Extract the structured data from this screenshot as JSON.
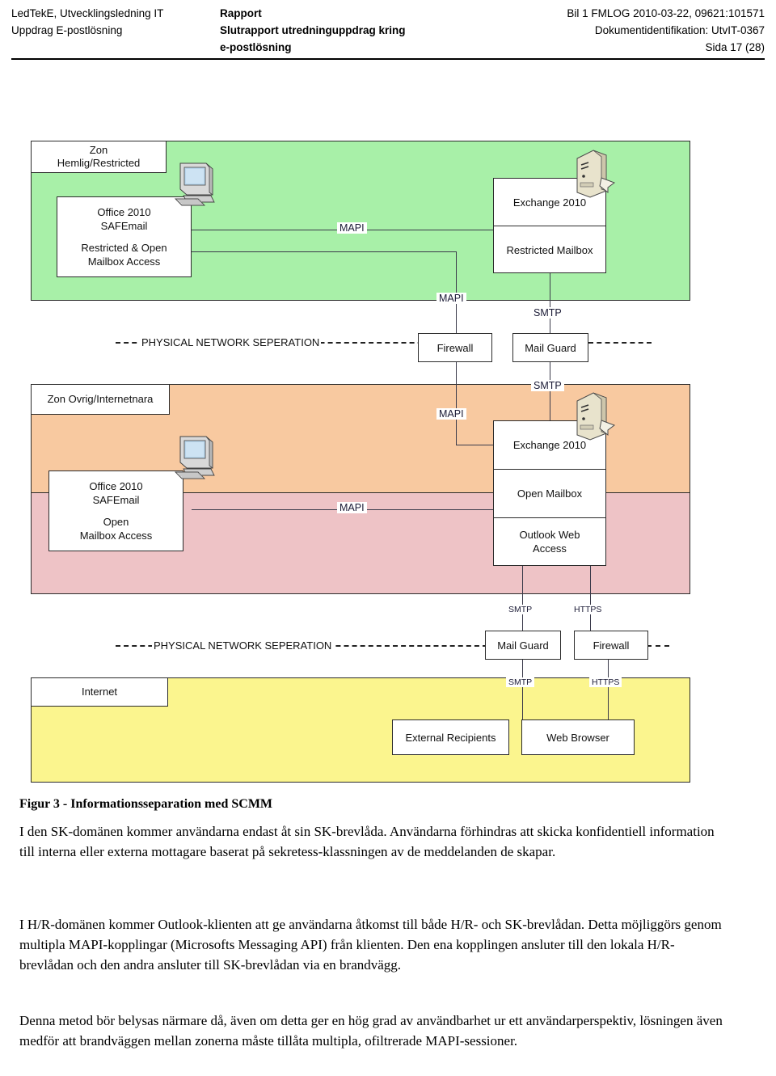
{
  "header": {
    "left_line1": "LedTekE, Utvecklingsledning IT",
    "left_line2": "Uppdrag E-postlösning",
    "mid_line1": "Rapport",
    "mid_line2": "Slutrapport utredninguppdrag kring",
    "mid_line3": "e-postlösning",
    "right_line1": "Bil 1 FMLOG 2010-03-22, 09621:101571",
    "right_line2": "Dokumentidentifikation: UtvIT-0367",
    "right_line3": "Sida 17 (28)"
  },
  "diagram": {
    "zones": {
      "secret": {
        "tab_line1": "Zon",
        "tab_line2": "Hemlig/Restricted",
        "color": "#a8f0a8"
      },
      "other_top": {
        "tab_line1": "Zon Ovrig/Internetnara",
        "color": "#f8c9a0"
      },
      "other_bottom": {
        "color": "#eec3c6"
      },
      "internet": {
        "tab_line1": "Internet",
        "color": "#fbf58e"
      }
    },
    "nodes": {
      "client_secret": {
        "line1": "Office 2010",
        "line2": "SAFEmail",
        "line3": "Restricted & Open",
        "line4": "Mailbox Access"
      },
      "exchange_secret": {
        "cell1": "Exchange 2010",
        "cell2": "Restricted Mailbox"
      },
      "firewall_top": "Firewall",
      "mailguard_top": "Mail Guard",
      "client_open": {
        "line1": "Office 2010",
        "line2": "SAFEmail",
        "line3": "Open",
        "line4": "Mailbox Access"
      },
      "exchange_open": {
        "cell1": "Exchange 2010",
        "cell2": "Open Mailbox",
        "cell3": "Outlook Web\nAccess"
      },
      "mailguard_bottom": "Mail Guard",
      "firewall_bottom": "Firewall",
      "external_recipients": "External Recipients",
      "web_browser": "Web Browser"
    },
    "separators": {
      "top_label": "PHYSICAL NETWORK SEPERATION",
      "bottom_label": "PHYSICAL NETWORK SEPERATION"
    },
    "protocols": {
      "mapi_secret_top": "MAPI",
      "mapi_secret_down": "MAPI",
      "smtp_secret_down": "SMTP",
      "mapi_open_down": "MAPI",
      "smtp_open_down": "SMTP",
      "mapi_open_h": "MAPI",
      "smtp_owa_down": "SMTP",
      "https_owa_down": "HTTPS",
      "smtp_internet": "SMTP",
      "https_internet": "HTTPS"
    }
  },
  "figure": {
    "caption": "Figur 3 - Informationsseparation med SCMM"
  },
  "body": {
    "p1": "I den SK-domänen kommer användarna endast åt sin SK-brevlåda. Användarna förhindras att skicka konfidentiell information till interna eller externa mottagare baserat på sekretess-klassningen av de meddelanden de skapar.",
    "p2": "I H/R-domänen kommer Outlook-klienten att ge användarna åtkomst till både H/R- och SK-brevlådan. Detta möjliggörs genom multipla MAPI-kopplingar  (Microsofts Messaging API) från klienten. Den ena kopplingen ansluter till den lokala H/R-brevlådan och den andra ansluter till SK-brevlådan via en brandvägg.",
    "p3": "Denna metod bör belysas närmare då, även om detta ger en hög grad av användbarhet ur ett användarperspektiv, lösningen även medför att brandväggen mellan zonerna måste tillåta multipla, ofiltrerade MAPI-sessioner."
  }
}
